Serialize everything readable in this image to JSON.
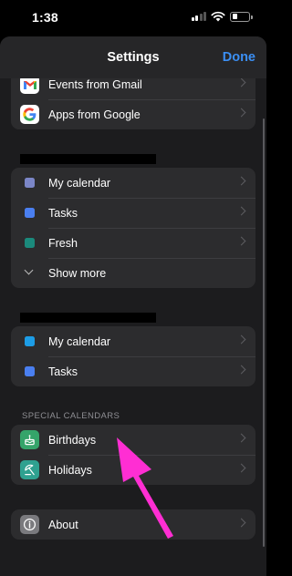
{
  "status_bar": {
    "time": "1:38"
  },
  "nav": {
    "title": "Settings",
    "done_label": "Done"
  },
  "accounts": [
    {
      "label": "Events from Gmail",
      "icon": "gmail-icon"
    },
    {
      "label": "Apps from Google",
      "icon": "google-icon"
    }
  ],
  "account_1": {
    "calendars": [
      {
        "label": "My calendar",
        "color": "#7b86c7"
      },
      {
        "label": "Tasks",
        "color": "#4a7ff0"
      },
      {
        "label": "Fresh",
        "color": "#1b8a7c"
      }
    ],
    "show_more_label": "Show more"
  },
  "account_2": {
    "calendars": [
      {
        "label": "My calendar",
        "color": "#1d9de6"
      },
      {
        "label": "Tasks",
        "color": "#4a7ff0"
      }
    ]
  },
  "special_calendars": {
    "header": "SPECIAL CALENDARS",
    "items": [
      {
        "label": "Birthdays",
        "icon": "birthday-cake-icon",
        "color": "#35a46a"
      },
      {
        "label": "Holidays",
        "icon": "holiday-umbrella-icon",
        "color": "#2fa190"
      }
    ]
  },
  "about": {
    "label": "About",
    "icon": "info-icon"
  },
  "annotation": {
    "arrow_color": "#ff2ed3"
  }
}
